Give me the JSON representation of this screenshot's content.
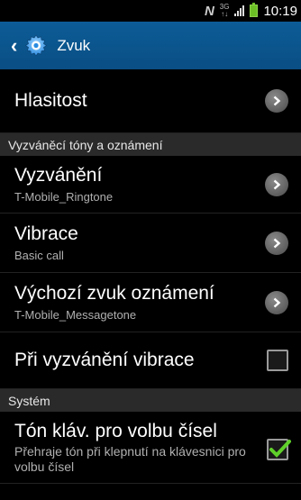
{
  "status_bar": {
    "network_letter": "N",
    "net_type_top": "3G",
    "net_type_bottom": "↑↓",
    "battery_color": "#6cc026",
    "time": "10:19"
  },
  "action_bar": {
    "title": "Zvuk",
    "icon": "gear-icon",
    "color": "#0c5c97"
  },
  "items": {
    "volume": {
      "title": "Hlasitost"
    },
    "ringtone": {
      "title": "Vyzvánění",
      "subtitle": "T-Mobile_Ringtone"
    },
    "vibration": {
      "title": "Vibrace",
      "subtitle": "Basic call"
    },
    "notification": {
      "title": "Výchozí zvuk oznámení",
      "subtitle": "T-Mobile_Messagetone"
    },
    "vibrate_on_ring": {
      "title": "Při vyzvánění vibrace",
      "checked": false
    },
    "dial_pad_tones": {
      "title": "Tón kláv. pro volbu čísel",
      "subtitle": "Přehraje tón při klepnutí na klávesnici pro volbu čísel",
      "checked": true
    }
  },
  "sections": {
    "ringtones": "Vyzváněcí tóny a oznámení",
    "system": "Systém"
  }
}
